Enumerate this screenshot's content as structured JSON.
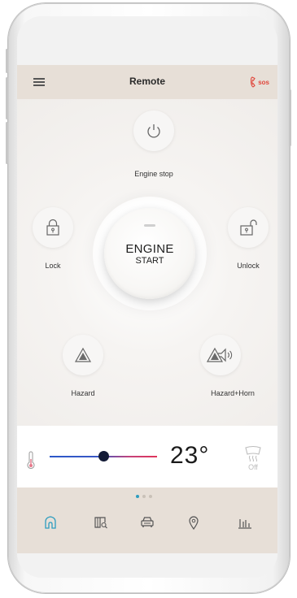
{
  "header": {
    "title": "Remote",
    "sos_label": "SOS"
  },
  "controls": {
    "engine_stop_label": "Engine stop",
    "lock_label": "Lock",
    "unlock_label": "Unlock",
    "hazard_label": "Hazard",
    "hazard_horn_label": "Hazard+Horn",
    "engine_start_main": "ENGINE",
    "engine_start_sub": "START"
  },
  "climate": {
    "temperature": "23°",
    "slider_level": 0.5,
    "defrost_status": "Off"
  },
  "navigation": {
    "page_indicator": {
      "total": 3,
      "active": 1
    },
    "items": [
      "home-icon",
      "map-book-icon",
      "car-icon",
      "location-pin-icon",
      "statistics-icon"
    ],
    "active_item": "home-icon"
  },
  "colors": {
    "accent": "#2d9dbf",
    "sos": "#e0473c",
    "header_bg": "#e7dfd7",
    "slider_cold": "#2b58c9",
    "slider_hot": "#e0345a"
  }
}
